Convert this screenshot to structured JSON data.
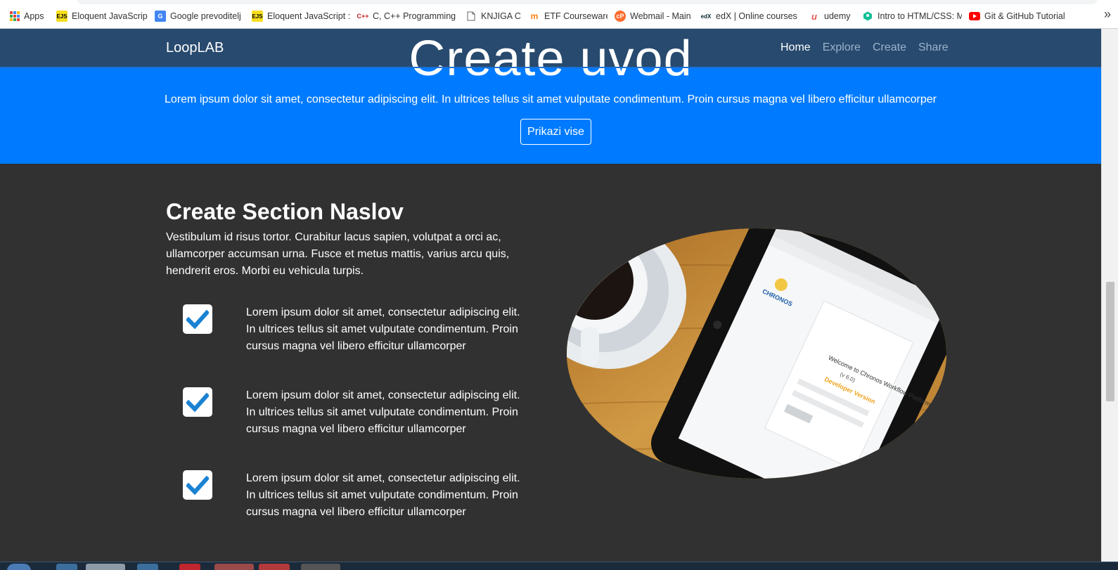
{
  "bookmarks": [
    {
      "label": "Apps",
      "icon": "apps-grid-icon"
    },
    {
      "label": "Eloquent JavaScript",
      "icon": "ejs-icon",
      "badge": "EJS"
    },
    {
      "label": "Google prevoditelj",
      "icon": "google-translate-icon"
    },
    {
      "label": "Eloquent JavaScript :",
      "icon": "ejs-icon",
      "badge": "EJS"
    },
    {
      "label": "C, C++ Programming",
      "icon": "cpp-icon",
      "badge": "C++"
    },
    {
      "label": "KNJIGA C",
      "icon": "document-icon"
    },
    {
      "label": "ETF Courseware",
      "icon": "moodle-icon"
    },
    {
      "label": "Webmail - Main",
      "icon": "cpanel-icon"
    },
    {
      "label": "edX | Online courses",
      "icon": "edx-icon",
      "badge": "edX"
    },
    {
      "label": "udemy",
      "icon": "udemy-icon"
    },
    {
      "label": "Intro to HTML/CSS: M",
      "icon": "khan-icon"
    },
    {
      "label": "Git & GitHub Tutorial",
      "icon": "youtube-icon"
    }
  ],
  "navbar": {
    "brand": "LoopLAB",
    "links": [
      "Home",
      "Explore",
      "Create",
      "Share"
    ],
    "active": "Home"
  },
  "hero": {
    "title": "Create uvod",
    "lead": "Lorem ipsum dolor sit amet, consectetur adipiscing elit. In ultrices tellus sit amet vulputate condimentum. Proin cursus magna vel libero efficitur ullamcorper",
    "button": "Prikazi vise"
  },
  "section": {
    "title": "Create Section Naslov",
    "description": "Vestibulum id risus tortor. Curabitur lacus sapien, volutpat a orci ac, ullamcorper accumsan urna. Fusce et metus mattis, varius arcu quis, hendrerit eros. Morbi eu vehicula turpis.",
    "features": [
      "Lorem ipsum dolor sit amet, consectetur adipiscing elit. In ultrices tellus sit amet vulputate condimentum. Proin cursus magna vel libero efficitur ullamcorper",
      "Lorem ipsum dolor sit amet, consectetur adipiscing elit. In ultrices tellus sit amet vulputate condimentum. Proin cursus magna vel libero efficitur ullamcorper",
      "Lorem ipsum dolor sit amet, consectetur adipiscing elit. In ultrices tellus sit amet vulputate condimentum. Proin cursus magna vel libero efficitur ullamcorper"
    ],
    "image": {
      "screen_heading": "Welcome to Chronos Workflow Platform!",
      "screen_version": "(v 6.0)",
      "screen_subtitle": "Developer Version",
      "logo_text": "CHRONOS"
    }
  },
  "colors": {
    "navbar_bg": "#284a6e",
    "hero_bg": "#007bff",
    "section_bg": "#313131",
    "check_color": "#1a82d2"
  }
}
